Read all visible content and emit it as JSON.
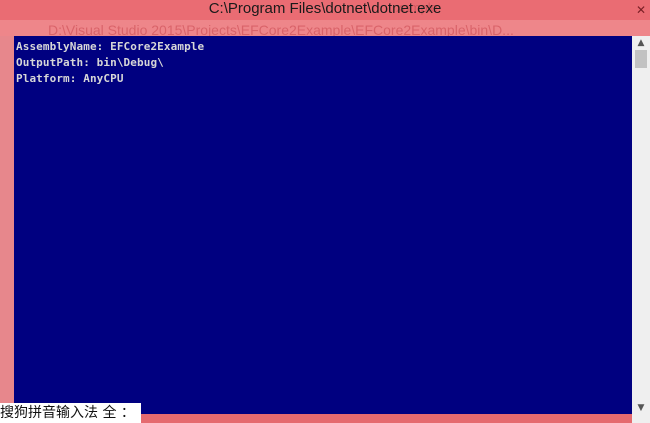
{
  "window": {
    "title": "C:\\Program Files\\dotnet\\dotnet.exe"
  },
  "background_window": {
    "path_text": "D:\\Visual Studio 2015\\Projects\\EFCore2Example\\EFCore2Example\\bin\\D...",
    "title_fragment": "xample"
  },
  "console": {
    "background_color": "#000080",
    "text_color": "#d7d7d7",
    "lines": [
      "AssemblyName: EFCore2Example",
      "OutputPath: bin\\Debug\\",
      "Platform: AnyCPU"
    ]
  },
  "ime": {
    "label": "搜狗拼音输入法 全 ："
  },
  "icons": {
    "scroll_up": "chevron-up-icon",
    "scroll_down": "chevron-down-icon",
    "close": "close-icon"
  }
}
